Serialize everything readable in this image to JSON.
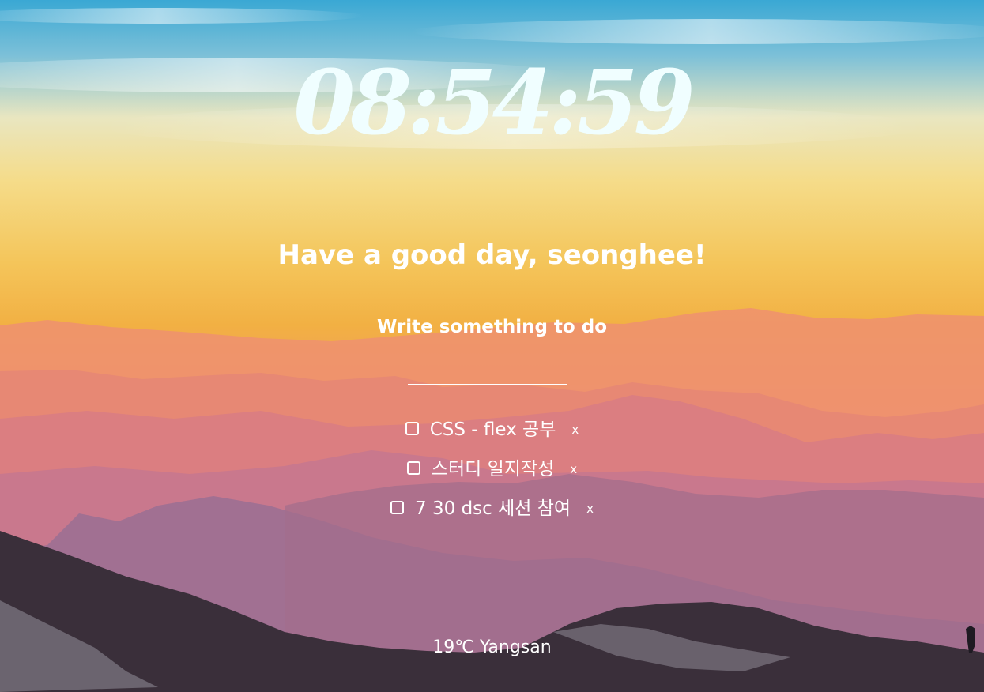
{
  "clock": {
    "time": "08:54:59"
  },
  "greeting": {
    "text": "Have a good day, seonghee!"
  },
  "todo": {
    "prompt": "Write something to do",
    "input_value": "",
    "delete_label": "x",
    "items": [
      {
        "text": "CSS - flex 공부"
      },
      {
        "text": "스터디 일지작성"
      },
      {
        "text": "7 30 dsc 세션 참여"
      }
    ]
  },
  "weather": {
    "temperature": "19℃",
    "city": "Yangsan",
    "display": "19℃ Yangsan"
  },
  "background": {
    "description_colors": [
      "#3aa8d4",
      "#f7e4a0",
      "#f2b53c",
      "#e8866a",
      "#c87a98",
      "#8e6a92",
      "#2e2530"
    ]
  }
}
